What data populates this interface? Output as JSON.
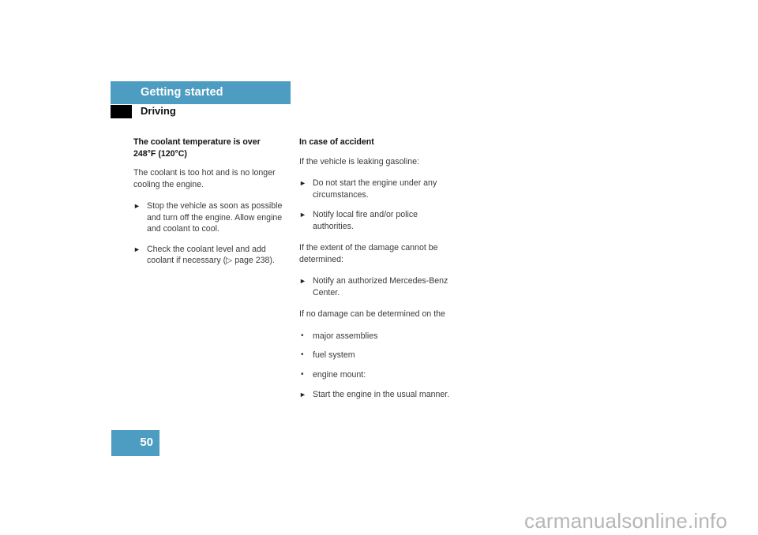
{
  "header": {
    "section_title": "Getting started",
    "subsection_title": "Driving",
    "bar_color": "#4d9cc1",
    "marker_color": "#000000"
  },
  "left_column": {
    "heading": "The coolant temperature is over 248°F (120°C)",
    "intro": "The coolant is too hot and is no longer cooling the engine.",
    "bullets": [
      {
        "marker": "►",
        "text": "Stop the vehicle as soon as possible and turn off the engine. Allow engine and coolant to cool."
      },
      {
        "marker": "►",
        "text": "Check the coolant level and add coolant if necessary (▷ page 238)."
      }
    ]
  },
  "right_column": {
    "heading": "In case of accident",
    "intro": "If the vehicle is leaking gasoline:",
    "bullets_one": [
      {
        "marker": "►",
        "text": "Do not start the engine under any circumstances."
      },
      {
        "marker": "►",
        "text": "Notify local fire and/or police authorities."
      }
    ],
    "para_two": "If the extent of the damage cannot be determined:",
    "bullets_two": [
      {
        "marker": "►",
        "text": "Notify an authorized Mercedes-Benz Center."
      }
    ],
    "para_three": "If no damage can be determined on the",
    "dot_items": [
      {
        "marker": "•",
        "text": "major assemblies"
      },
      {
        "marker": "•",
        "text": "fuel system"
      },
      {
        "marker": "•",
        "text": "engine mount:"
      }
    ],
    "bullets_three": [
      {
        "marker": "►",
        "text": "Start the engine in the usual manner."
      }
    ]
  },
  "footer": {
    "page_number": "50",
    "page_box_color": "#4d9cc1",
    "watermark": "carmanualsonline.info"
  }
}
